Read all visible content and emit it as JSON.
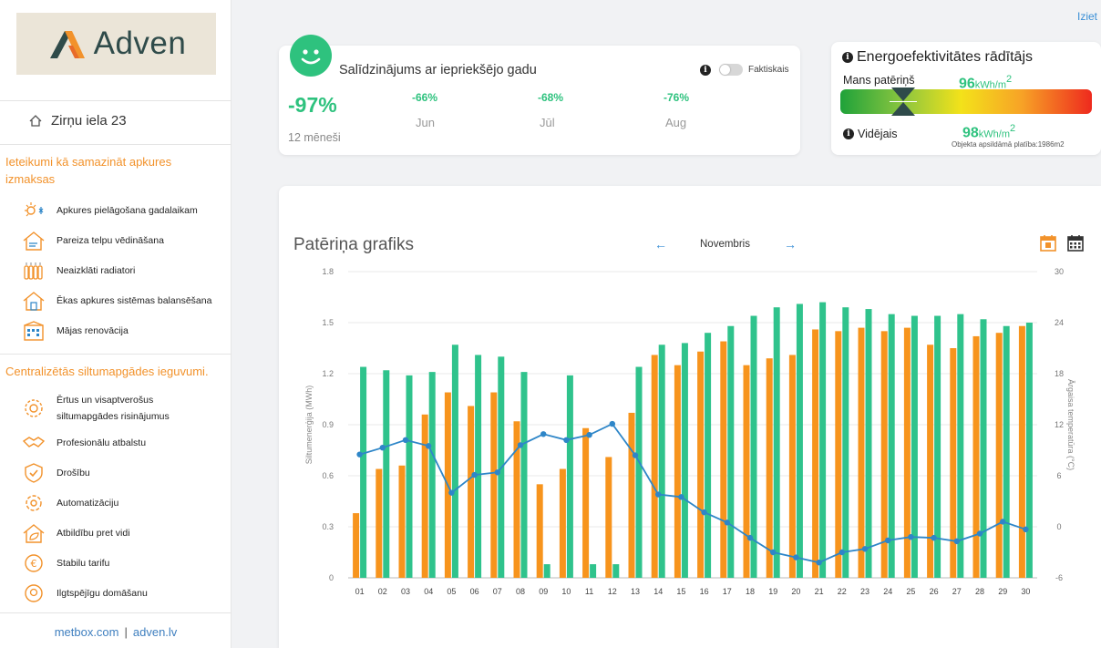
{
  "logo": {
    "text": "Adven"
  },
  "top_link": {
    "logout": "Iziet"
  },
  "sidebar": {
    "address": "Zirņu iela 23",
    "tips_title": "Ieteikumi kā samazināt apkures izmaksas",
    "tips": [
      {
        "label": "Apkures pielāgošana gadalaikam",
        "icon": "sun-snow-icon"
      },
      {
        "label": "Pareiza telpu vēdināšana",
        "icon": "ventilation-icon"
      },
      {
        "label": "Neaizklāti radiatori",
        "icon": "radiator-icon"
      },
      {
        "label": "Ēkas apkures sistēmas balansēšana",
        "icon": "house-balance-icon"
      },
      {
        "label": "Mājas renovācija",
        "icon": "building-icon"
      }
    ],
    "benefits_title": "Centralizētās siltumapgādes ieguvumi.",
    "benefits": [
      {
        "label": "Ērtus un visaptverošus",
        "label2": "siltumapgādes risinājumus",
        "icon": "gear-star-icon"
      },
      {
        "label": "Profesionālu atbalstu",
        "icon": "handshake-icon"
      },
      {
        "label": "Drošību",
        "icon": "shield-check-icon"
      },
      {
        "label": "Automatizāciju",
        "icon": "automation-gear-icon"
      },
      {
        "label": "Atbildību pret vidi",
        "icon": "eco-house-icon"
      },
      {
        "label": "Stabilu tarifu",
        "icon": "euro-icon"
      },
      {
        "label": "Ilgtspējīgu domāšanu",
        "icon": "head-gear-icon"
      }
    ],
    "footer": {
      "link1": "metbox.com",
      "separator": "|",
      "link2": "adven.lv"
    }
  },
  "comparison": {
    "title": "Salīdzinājums ar iepriekšējo gadu",
    "toggle_label": "Faktiskais",
    "total_pct": "-97%",
    "period_label": "12 mēneši",
    "months": [
      {
        "pct": "-66%",
        "name": "Jun"
      },
      {
        "pct": "-68%",
        "name": "Jūl"
      },
      {
        "pct": "-76%",
        "name": "Aug"
      }
    ]
  },
  "efficiency": {
    "title": "Energoefektivitātes rādītājs",
    "my_label": "Mans patēriņš",
    "my_value": "96",
    "unit": "kWh/m",
    "unit_sup": "2",
    "avg_label": "Vidējais",
    "avg_value": "98",
    "area_note": "Objekta apsildāmā platība:1986m2"
  },
  "chart_header": {
    "title": "Patēriņa grafiks",
    "month": "Novembris",
    "prev": "←",
    "next": "→"
  },
  "colors": {
    "green_bar": "#2fc38c",
    "orange_bar": "#f7941d",
    "temp_line": "#2e86c8",
    "accent_orange": "#f2922b",
    "accent_green": "#2ec27e"
  },
  "chart_data": {
    "type": "bar",
    "categories": [
      "01",
      "02",
      "03",
      "04",
      "05",
      "06",
      "07",
      "08",
      "09",
      "10",
      "11",
      "12",
      "13",
      "14",
      "15",
      "16",
      "17",
      "18",
      "19",
      "20",
      "21",
      "22",
      "23",
      "24",
      "25",
      "26",
      "27",
      "28",
      "29",
      "30"
    ],
    "series": [
      {
        "type": "bar",
        "axis": "left",
        "color": "#f7941d",
        "values": [
          0.38,
          0.64,
          0.66,
          0.96,
          1.09,
          1.01,
          1.09,
          0.92,
          0.55,
          0.64,
          0.88,
          0.71,
          0.97,
          1.31,
          1.25,
          1.33,
          1.39,
          1.25,
          1.29,
          1.31,
          1.46,
          1.45,
          1.47,
          1.45,
          1.47,
          1.37,
          1.35,
          1.42,
          1.44,
          1.48
        ]
      },
      {
        "type": "bar",
        "axis": "left",
        "color": "#2fc38c",
        "values": [
          1.24,
          1.22,
          1.19,
          1.21,
          1.37,
          1.31,
          1.3,
          1.21,
          0.08,
          1.19,
          0.08,
          0.08,
          1.24,
          1.37,
          1.38,
          1.44,
          1.48,
          1.54,
          1.59,
          1.61,
          1.62,
          1.59,
          1.58,
          1.55,
          1.54,
          1.54,
          1.55,
          1.52,
          1.48,
          1.5
        ]
      },
      {
        "type": "line",
        "axis": "right",
        "color": "#2e86c8",
        "values": [
          8.5,
          9.3,
          10.2,
          9.5,
          4.0,
          6.1,
          6.4,
          9.6,
          10.9,
          10.2,
          10.8,
          12.1,
          8.4,
          3.8,
          3.5,
          1.7,
          0.5,
          -1.3,
          -3.0,
          -3.6,
          -4.2,
          -3.0,
          -2.6,
          -1.6,
          -1.2,
          -1.3,
          -1.7,
          -0.8,
          0.6,
          -0.3
        ]
      }
    ],
    "y_left": {
      "label": "Siltumenerģija (MWh)",
      "lim": [
        0,
        1.8
      ],
      "ticks": [
        "0",
        "0.3",
        "0.6",
        "0.9",
        "1.2",
        "1.5",
        "1.8"
      ]
    },
    "y_right": {
      "label": "Ārgaisa temperatūra (°C)",
      "lim": [
        -6,
        30
      ],
      "ticks": [
        "-6",
        "0",
        "6",
        "12",
        "18",
        "24",
        "30"
      ]
    },
    "grid": true
  }
}
